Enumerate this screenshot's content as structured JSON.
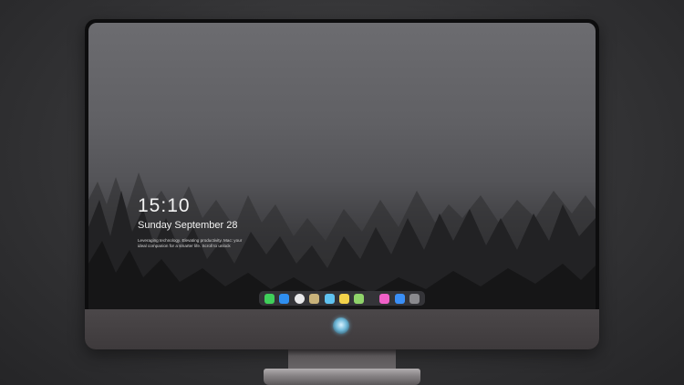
{
  "lock_screen": {
    "time": "15:10",
    "date": "Sunday September 28",
    "tagline": "Leveraging technology. Elevating productivity. Mac: your ideal companion for a smarter life. Scroll to unlock"
  },
  "dock": {
    "items": [
      {
        "name": "messages-icon",
        "color": "#3fcf5a"
      },
      {
        "name": "mail-icon",
        "color": "#2f8ff0"
      },
      {
        "name": "safari-icon",
        "color": "#e8e8ea"
      },
      {
        "name": "preview-icon",
        "color": "#c8b27a"
      },
      {
        "name": "finder-icon",
        "color": "#5fc2f0"
      },
      {
        "name": "notes-icon",
        "color": "#f3d24a"
      },
      {
        "name": "photos-icon",
        "color": "#8fd36a"
      },
      {
        "name": "music-icon",
        "color": "#f060c8"
      },
      {
        "name": "app-store-icon",
        "color": "#3a8ff6"
      },
      {
        "name": "camera-icon",
        "color": "#8a8a8e"
      }
    ]
  }
}
